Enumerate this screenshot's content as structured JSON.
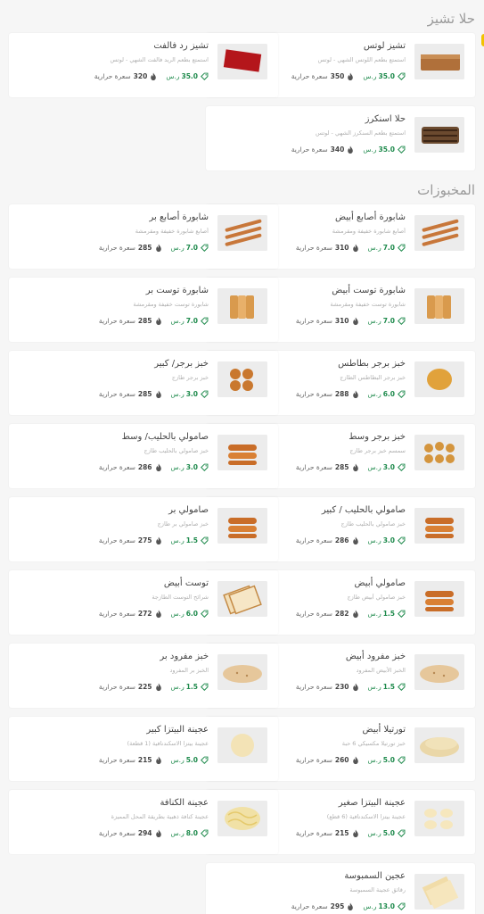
{
  "sections": [
    {
      "title": "حلا تشيز",
      "items": [
        {
          "name": "تشيز لوتس",
          "desc": "استمتع بطعم اللوتس الشهي - لوتس",
          "price": "35.0",
          "calories": "350",
          "img": "lotus"
        },
        {
          "name": "تشيز رد فالفت",
          "desc": "استمتع بطعم الريد فالفت الشهي - لوتس",
          "price": "35.0",
          "calories": "320",
          "img": "redvelvet"
        },
        {
          "name": "حلا اسنكرز",
          "desc": "استمتع بطعم السنكرز الشهي - لوتس",
          "price": "35.0",
          "calories": "340",
          "img": "snickers"
        }
      ]
    },
    {
      "title": "المخبوزات",
      "items": [
        {
          "name": "شابورة أصابع أبيض",
          "desc": "أصابع شابورة خفيفة ومقرمشة",
          "price": "7.0",
          "calories": "310",
          "img": "sticks"
        },
        {
          "name": "شابورة أصابع بر",
          "desc": "أصابع شابورة خفيفة ومقرمشة",
          "price": "7.0",
          "calories": "285",
          "img": "sticks"
        },
        {
          "name": "شابورة توست أبيض",
          "desc": "شابورة توست خفيفة ومقرمشة",
          "price": "7.0",
          "calories": "310",
          "img": "rusk"
        },
        {
          "name": "شابورة توست بر",
          "desc": "شابورة توست خفيفة ومقرمشة",
          "price": "7.0",
          "calories": "285",
          "img": "rusk"
        },
        {
          "name": "خبز برجر بطاطس",
          "desc": "خبز برجر البطاطس الطازج",
          "price": "6.0",
          "calories": "288",
          "img": "bun1"
        },
        {
          "name": "خبز برجر/ كبير",
          "desc": "خبز برجر طازج",
          "price": "3.0",
          "calories": "285",
          "img": "bun4"
        },
        {
          "name": "خبز برجر وسط",
          "desc": "سمسم خبز برجر طازج",
          "price": "3.0",
          "calories": "285",
          "img": "bun6"
        },
        {
          "name": "صامولي بالحليب/ وسط",
          "desc": "خبز صامولي بالحليب طازج",
          "price": "3.0",
          "calories": "286",
          "img": "hotdog"
        },
        {
          "name": "صامولي بالحليب / كبير",
          "desc": "خبز صامولي بالحليب طازج",
          "price": "3.0",
          "calories": "286",
          "img": "hotdog"
        },
        {
          "name": "صامولي بر",
          "desc": "خبز صامولي بر طازج",
          "price": "1.5",
          "calories": "275",
          "img": "hotdog"
        },
        {
          "name": "صامولي أبيض",
          "desc": "خبز صامولي أبيض طازج",
          "price": "1.5",
          "calories": "282",
          "img": "hotdog"
        },
        {
          "name": "توست أبيض",
          "desc": "شرائح التوست الطازجة",
          "price": "6.0",
          "calories": "272",
          "img": "toast"
        },
        {
          "name": "خبز مفرود أبيض",
          "desc": "الخبز الأبيض المفرود",
          "price": "1.5",
          "calories": "230",
          "img": "pita"
        },
        {
          "name": "خبز مفرود بر",
          "desc": "الخبز بر المفرود",
          "price": "1.5",
          "calories": "225",
          "img": "pita"
        },
        {
          "name": "تورتيلا أبيض",
          "desc": "خبز تورتيلا مكسيكي 6 حبة",
          "price": "5.0",
          "calories": "260",
          "img": "tortilla"
        },
        {
          "name": "عجينة البيتزا كبير",
          "desc": "عجينة بيتزا الاسكندنافية (1 قطعة)",
          "price": "5.0",
          "calories": "215",
          "img": "dough1"
        },
        {
          "name": "عجينة البيتزا صغير",
          "desc": "عجينة بيتزا الاسكندنافية (6 قطع)",
          "price": "5.0",
          "calories": "215",
          "img": "dough6"
        },
        {
          "name": "عجينة الكنافة",
          "desc": "عجينة كنافة ذهبية بطريقة المحل المميزة",
          "price": "8.0",
          "calories": "294",
          "img": "kunafa"
        },
        {
          "name": "عجين السمبوسة",
          "desc": "رقائق عجينة السمبوسة",
          "price": "13.0",
          "calories": "295",
          "img": "samosa"
        }
      ]
    }
  ],
  "labels": {
    "currency": "ر.س",
    "calories": "سعرة حرارية"
  },
  "colors": {
    "price": "#1e8a4c",
    "accent": "#f2c200"
  }
}
